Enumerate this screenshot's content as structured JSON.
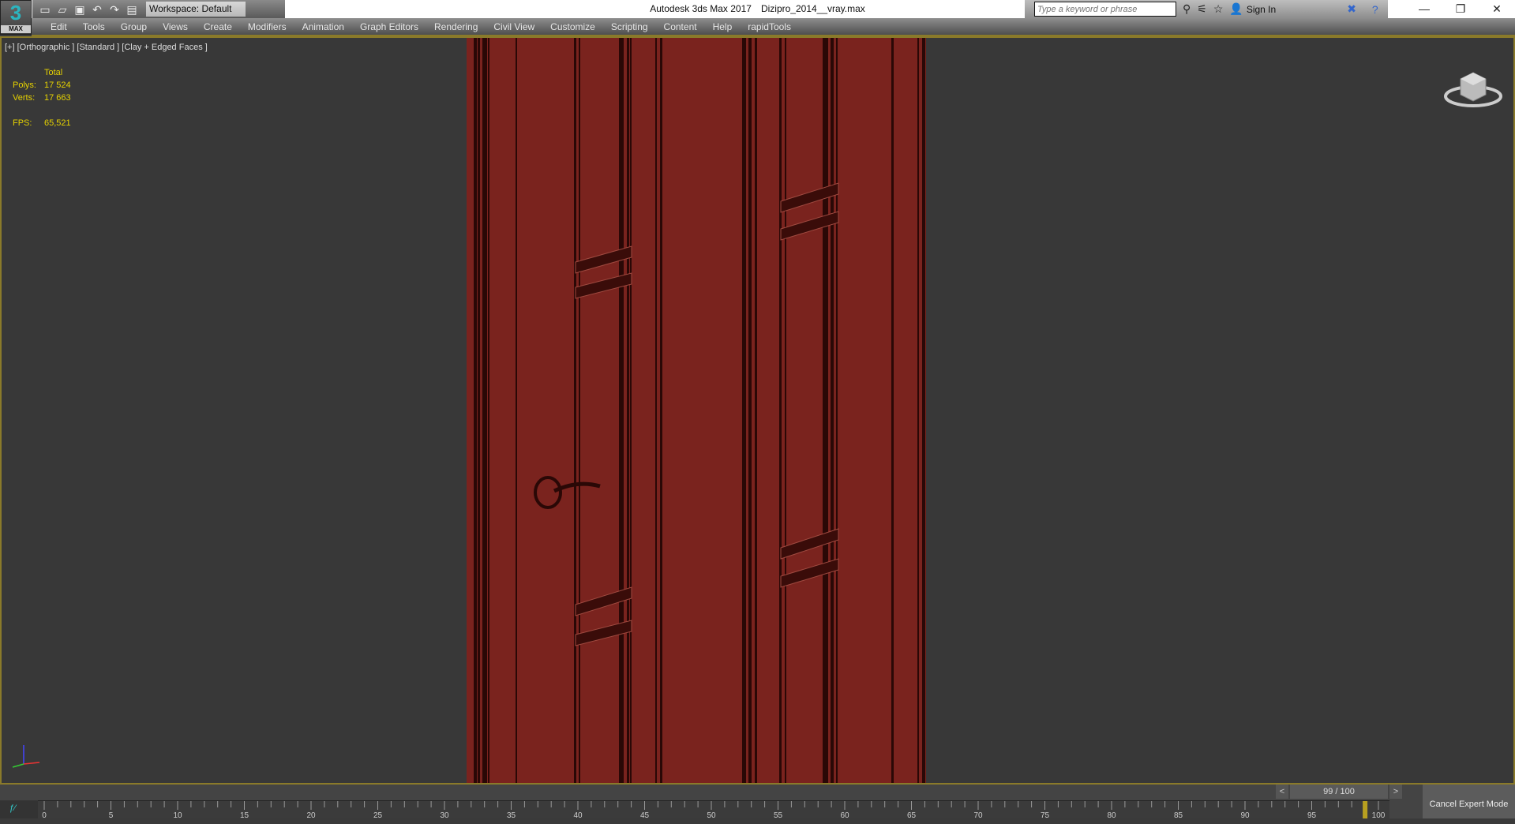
{
  "app": {
    "logo_text": "MAX",
    "title": "Autodesk 3ds Max 2017",
    "file": "Dizipro_2014__vray.max"
  },
  "toolbar": {
    "workspace": "Workspace: Default"
  },
  "search": {
    "placeholder": "Type a keyword or phrase",
    "sign_in": "Sign In"
  },
  "menu": [
    "Edit",
    "Tools",
    "Group",
    "Views",
    "Create",
    "Modifiers",
    "Animation",
    "Graph Editors",
    "Rendering",
    "Civil View",
    "Customize",
    "Scripting",
    "Content",
    "Help",
    "rapidTools"
  ],
  "viewport": {
    "label": "[+] [Orthographic ] [Standard ] [Clay + Edged Faces ]",
    "stats": {
      "header": "Total",
      "polys_label": "Polys:",
      "polys": "17 524",
      "verts_label": "Verts:",
      "verts": "17 663",
      "fps_label": "FPS:",
      "fps": "65,521"
    }
  },
  "timeline": {
    "frame": "99 / 100",
    "prev": "<",
    "next": ">",
    "current": 99,
    "max": 100,
    "ticks": [
      0,
      5,
      10,
      15,
      20,
      25,
      30,
      35,
      40,
      45,
      50,
      55,
      60,
      65,
      70,
      75,
      80,
      85,
      90,
      95,
      100
    ],
    "cancel_expert": "Cancel Expert Mode"
  },
  "colors": {
    "door": "#7a231e",
    "accent": "#8a7a2a",
    "stats": "#e6d200"
  }
}
